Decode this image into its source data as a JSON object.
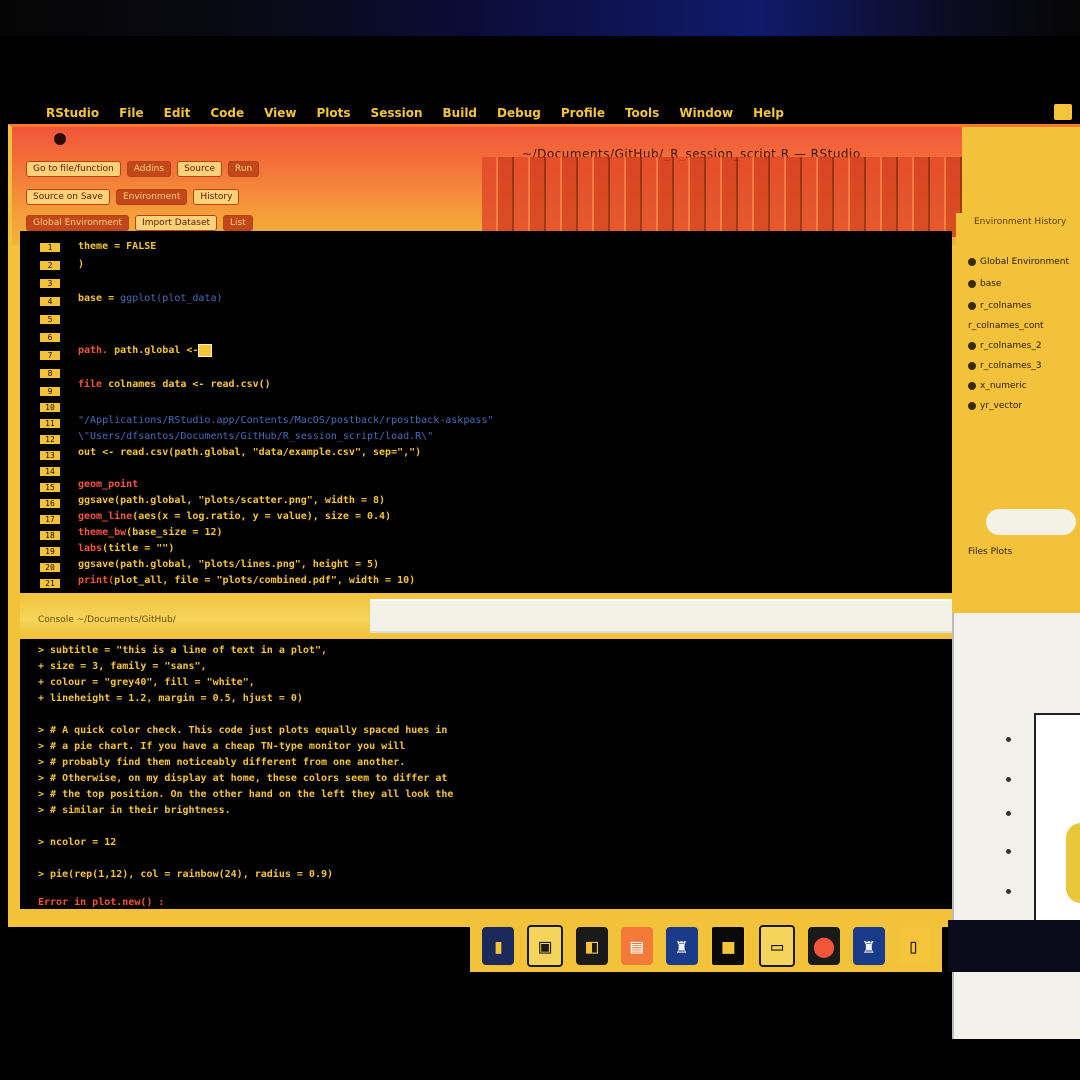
{
  "menubar": {
    "apple_glyph": "",
    "items": [
      "RStudio",
      "File",
      "Edit",
      "Code",
      "View",
      "Plots",
      "Session",
      "Build",
      "Debug",
      "Profile",
      "Tools",
      "Window",
      "Help"
    ]
  },
  "window": {
    "title": "~/Documents/GitHub/_R_session_script.R — RStudio"
  },
  "toolbar": {
    "row1": [
      "Go to file/function",
      "Addins",
      "Source",
      "Run"
    ],
    "row2": [
      "Source on Save",
      "Environment",
      "History"
    ],
    "row3": [
      "Global Environment",
      "Import Dataset",
      "List"
    ]
  },
  "editor": {
    "line_numbers": [
      "1",
      "2",
      "3",
      "4",
      "5",
      "6",
      "7",
      "8",
      "9",
      "10",
      "11",
      "12",
      "13",
      "14",
      "15",
      "16",
      "17",
      "18",
      "19",
      "20",
      "21"
    ],
    "lines": [
      {
        "kw": "",
        "text": "  theme = FALSE"
      },
      {
        "kw": "",
        "text": ")"
      },
      {
        "kw": "",
        "text": ""
      },
      {
        "kw": "",
        "text": "base = ",
        "blue": "ggplot(plot_data)"
      },
      {
        "kw": "",
        "text": ""
      },
      {
        "kw": "",
        "text": ""
      },
      {
        "kw": "path.",
        "text": "   path.global <- ",
        "hl": "  "
      },
      {
        "kw": "",
        "text": ""
      },
      {
        "kw": "file",
        "text": "  colnames  ",
        "tail": "data <- read.csv()"
      },
      {
        "kw": "",
        "text": ""
      },
      {
        "kw": "",
        "text": "  \"/Applications/RStudio.app/Contents/MacOS/postback/rpostback-askpass\""
      },
      {
        "kw": "",
        "text": "\\\"Users/dfsantos/Documents/GitHub/R_session_script/load.R\\\""
      },
      {
        "kw": "",
        "text": " out <- read.csv(path.global, \"data/example.csv\", sep=\",\")"
      },
      {
        "kw": "",
        "text": ""
      },
      {
        "kw": "geom_point",
        "text": ""
      },
      {
        "kw": "",
        "text": "  ggsave(path.global, \"plots/scatter.png\", width = 8)"
      },
      {
        "kw": "geom_line",
        "text": "(aes(x = log.ratio, y = value), size = 0.4)"
      },
      {
        "kw": "theme_bw",
        "text": "(base_size = 12)"
      },
      {
        "kw": "labs",
        "text": "(title = \"\")"
      },
      {
        "kw": "",
        "text": "  ggsave(path.global, \"plots/lines.png\", height = 5)"
      },
      {
        "kw": "print(",
        "text": "plot_all, file = \"plots/combined.pdf\", width = 10)"
      }
    ]
  },
  "split_bar": {
    "label": "Console   ~/Documents/GitHub/"
  },
  "console": {
    "lines": [
      "> subtitle = \"this is a line of text in a plot\",",
      "+      size = 3, family = \"sans\",",
      "+      colour = \"grey40\", fill = \"white\",",
      "+      lineheight = 1.2, margin = 0.5, hjust = 0)",
      "",
      "> # A quick color check.      This code just plots equally spaced hues in",
      "> # a pie chart.        If you have a cheap TN-type monitor you will",
      "> # probably find them noticeably different from one another.",
      "> # Otherwise,  on my display at home, these colors seem to differ at",
      "> # the top position.  On the other hand on the left they all look the",
      "> # similar in their brightness.",
      "",
      "> ncolor = 12",
      "",
      "> pie(rep(1,12), col = rainbow(24), radius = 0.9)"
    ],
    "status": "Error in plot.new() :"
  },
  "right_panel": {
    "header": "Environment  History",
    "entries": [
      "Global Environment",
      "base",
      "r_colnames",
      "r_colnames_cont",
      "r_colnames_2",
      "r_colnames_3",
      "x_numeric",
      "yr_vector"
    ],
    "footer": "Files  Plots"
  },
  "dock": {
    "apps": [
      "finder-app",
      "textedit-app",
      "terminal-app",
      "calendar-app",
      "rstudio-app",
      "preview-app",
      "notes-app",
      "safari-app",
      "mail-app",
      "trash-app"
    ],
    "glyphs": [
      "▮",
      "▣",
      "◧",
      "▤",
      "♜",
      "■",
      "▭",
      "⬤",
      "♜",
      "▯"
    ]
  }
}
